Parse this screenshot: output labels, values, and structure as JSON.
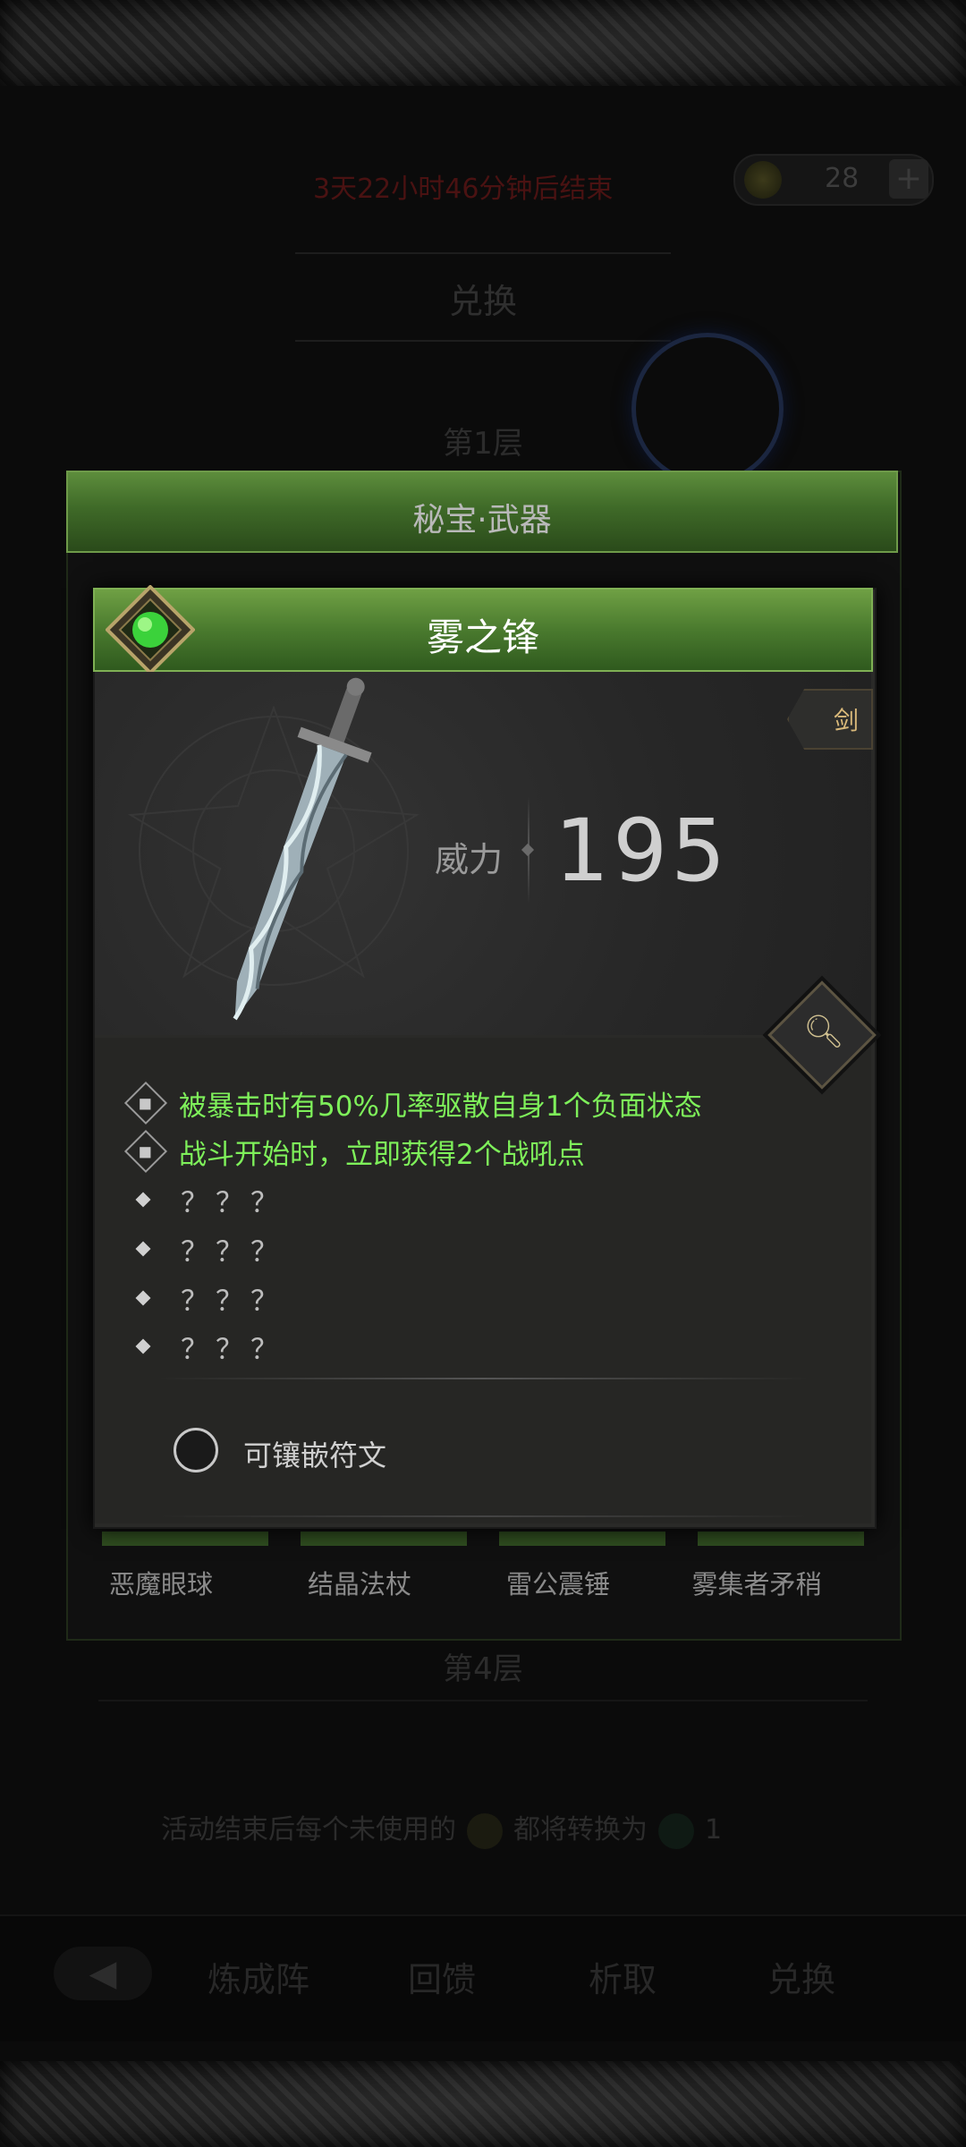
{
  "background": {
    "timer": "3天22小时46分钟后结束",
    "currency_count": "28",
    "currency_plus": "+",
    "title": "兑换",
    "floor_1": "第1层",
    "floor_4": "第4层",
    "note_prefix": "活动结束后每个未使用的",
    "note_middle": "都将转换为",
    "note_count": "1",
    "nav": {
      "back": "◀",
      "items": [
        "炼成阵",
        "回馈",
        "析取",
        "兑换"
      ]
    }
  },
  "panel": {
    "title": "秘宝·武器",
    "items": [
      "恶魔眼球",
      "结晶法杖",
      "雷公震锤",
      "雾集者矛稍"
    ]
  },
  "card": {
    "title": "雾之锋",
    "weapon_type": "剑",
    "power_label": "威力",
    "power_value": "195",
    "effects": [
      "被暴击时有50%几率驱散自身1个负面状态",
      "战斗开始时，立即获得2个战吼点"
    ],
    "unknown_effects": [
      "？？？",
      "？？？",
      "？？？",
      "？？？"
    ],
    "rune_label": "可镶嵌符文"
  },
  "colors": {
    "header_green": "#4a7a2e",
    "effect_green": "#7ef05a",
    "power_text": "#cfcfcf"
  }
}
